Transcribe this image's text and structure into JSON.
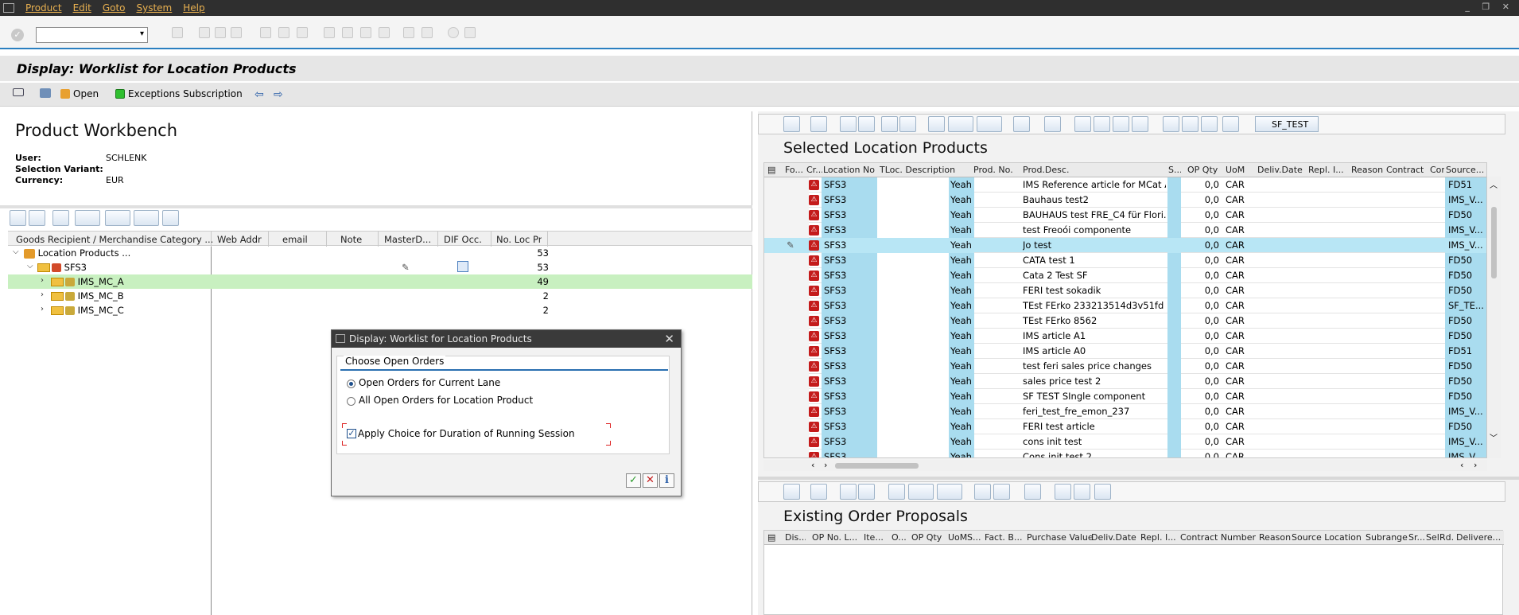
{
  "menu": [
    "Product",
    "Edit",
    "Goto",
    "System",
    "Help"
  ],
  "window_controls": "_ ❐ ✕",
  "title": "Display: Worklist for Location Products",
  "app_toolbar": {
    "open": "Open",
    "exceptions": "Exceptions Subscription"
  },
  "workbench": {
    "title": "Product Workbench",
    "user_label": "User:",
    "user_value": "SCHLENK",
    "variant_label": "Selection Variant:",
    "variant_value": "",
    "currency_label": "Currency:",
    "currency_value": "EUR"
  },
  "tree": {
    "headers": [
      "Goods Recipient / Merchandise Category ...",
      "Web Addr",
      "email",
      "Note",
      "MasterD...",
      "DIF Occ.",
      "No. Loc Pr"
    ],
    "rows": [
      {
        "label": "Location Products ...",
        "count": "53"
      },
      {
        "label": "SFS3",
        "count": "53"
      },
      {
        "label": "IMS_MC_A",
        "count": "49"
      },
      {
        "label": "IMS_MC_B",
        "count": "2"
      },
      {
        "label": "IMS_MC_C",
        "count": "2"
      }
    ]
  },
  "selected_products": {
    "toolbar_button": "SF_TEST",
    "title": "Selected Location Products",
    "headers": [
      "Fo...",
      "Cr...",
      "Location No",
      "TLoc. Description",
      "",
      "Prod. No.",
      "Prod.Desc.",
      "S...",
      "OP Qty",
      "UoM",
      "Deliv.Date",
      "Repl. I...",
      "Reason",
      "Contract",
      "Cor",
      "Source..."
    ],
    "rows": [
      {
        "loc": "SFS3",
        "yeah": "Yeah",
        "desc": "IMS Reference article for MCat A",
        "qty": "0,0",
        "uom": "CAR",
        "src": "FD51"
      },
      {
        "loc": "SFS3",
        "yeah": "Yeah",
        "desc": "Bauhaus test2",
        "qty": "0,0",
        "uom": "CAR",
        "src": "IMS_V..."
      },
      {
        "loc": "SFS3",
        "yeah": "Yeah",
        "desc": "BAUHAUS test FRE_C4 für Flori...",
        "qty": "0,0",
        "uom": "CAR",
        "src": "FD50"
      },
      {
        "loc": "SFS3",
        "yeah": "Yeah",
        "desc": "test Freoói componente",
        "qty": "0,0",
        "uom": "CAR",
        "src": "IMS_V..."
      },
      {
        "loc": "SFS3",
        "yeah": "Yeah",
        "desc": "Jo test",
        "qty": "0,0",
        "uom": "CAR",
        "src": "IMS_V..."
      },
      {
        "loc": "SFS3",
        "yeah": "Yeah",
        "desc": "CATA test 1",
        "qty": "0,0",
        "uom": "CAR",
        "src": "FD50"
      },
      {
        "loc": "SFS3",
        "yeah": "Yeah",
        "desc": "Cata 2 Test SF",
        "qty": "0,0",
        "uom": "CAR",
        "src": "FD50"
      },
      {
        "loc": "SFS3",
        "yeah": "Yeah",
        "desc": "FERI test sokadik",
        "qty": "0,0",
        "uom": "CAR",
        "src": "FD50"
      },
      {
        "loc": "SFS3",
        "yeah": "Yeah",
        "desc": "TEst FErko 233213514d3v51fd",
        "qty": "0,0",
        "uom": "CAR",
        "src": "SF_TE..."
      },
      {
        "loc": "SFS3",
        "yeah": "Yeah",
        "desc": "TEst FErko 8562",
        "qty": "0,0",
        "uom": "CAR",
        "src": "FD50"
      },
      {
        "loc": "SFS3",
        "yeah": "Yeah",
        "desc": "IMS article  A1",
        "qty": "0,0",
        "uom": "CAR",
        "src": "FD50"
      },
      {
        "loc": "SFS3",
        "yeah": "Yeah",
        "desc": "IMS article  A0",
        "qty": "0,0",
        "uom": "CAR",
        "src": "FD51"
      },
      {
        "loc": "SFS3",
        "yeah": "Yeah",
        "desc": "test feri sales price changes",
        "qty": "0,0",
        "uom": "CAR",
        "src": "FD50"
      },
      {
        "loc": "SFS3",
        "yeah": "Yeah",
        "desc": "sales price test 2",
        "qty": "0,0",
        "uom": "CAR",
        "src": "FD50"
      },
      {
        "loc": "SFS3",
        "yeah": "Yeah",
        "desc": "SF TEST SIngle component",
        "qty": "0,0",
        "uom": "CAR",
        "src": "FD50"
      },
      {
        "loc": "SFS3",
        "yeah": "Yeah",
        "desc": "feri_test_fre_emon_237",
        "qty": "0,0",
        "uom": "CAR",
        "src": "IMS_V..."
      },
      {
        "loc": "SFS3",
        "yeah": "Yeah",
        "desc": "FERI test article",
        "qty": "0,0",
        "uom": "CAR",
        "src": "FD50"
      },
      {
        "loc": "SFS3",
        "yeah": "Yeah",
        "desc": "cons init test",
        "qty": "0,0",
        "uom": "CAR",
        "src": "IMS_V..."
      },
      {
        "loc": "SFS3",
        "yeah": "Yeah",
        "desc": "Cons init test 2",
        "qty": "0,0",
        "uom": "CAR",
        "src": "IMS_V..."
      }
    ]
  },
  "order_proposals": {
    "title": "Existing Order Proposals",
    "headers": [
      "Dis...",
      "OP No. L...",
      "Ite...",
      "O...",
      "OP Qty",
      "UoM",
      "S...",
      "Fact. B...",
      "Purchase Value",
      "Deliv.Date",
      "Repl. I...",
      "Contract Number",
      "Reason",
      "Source Location",
      "Subrange",
      "Sr...",
      "Sel",
      "Rd.",
      "Delivere..."
    ]
  },
  "dialog": {
    "title": "Display: Worklist for Location Products",
    "frame_label": "Choose Open Orders",
    "option1": "Open Orders for Current Lane",
    "option2": "All Open Orders for Location Product",
    "checkbox": "Apply Choice for Duration of Running Session"
  },
  "colors": {
    "accent": "#2a7fc0",
    "selection": "#b8e6f5",
    "tree_selection": "#c8f0c0",
    "error_badge": "#c41b1b"
  }
}
